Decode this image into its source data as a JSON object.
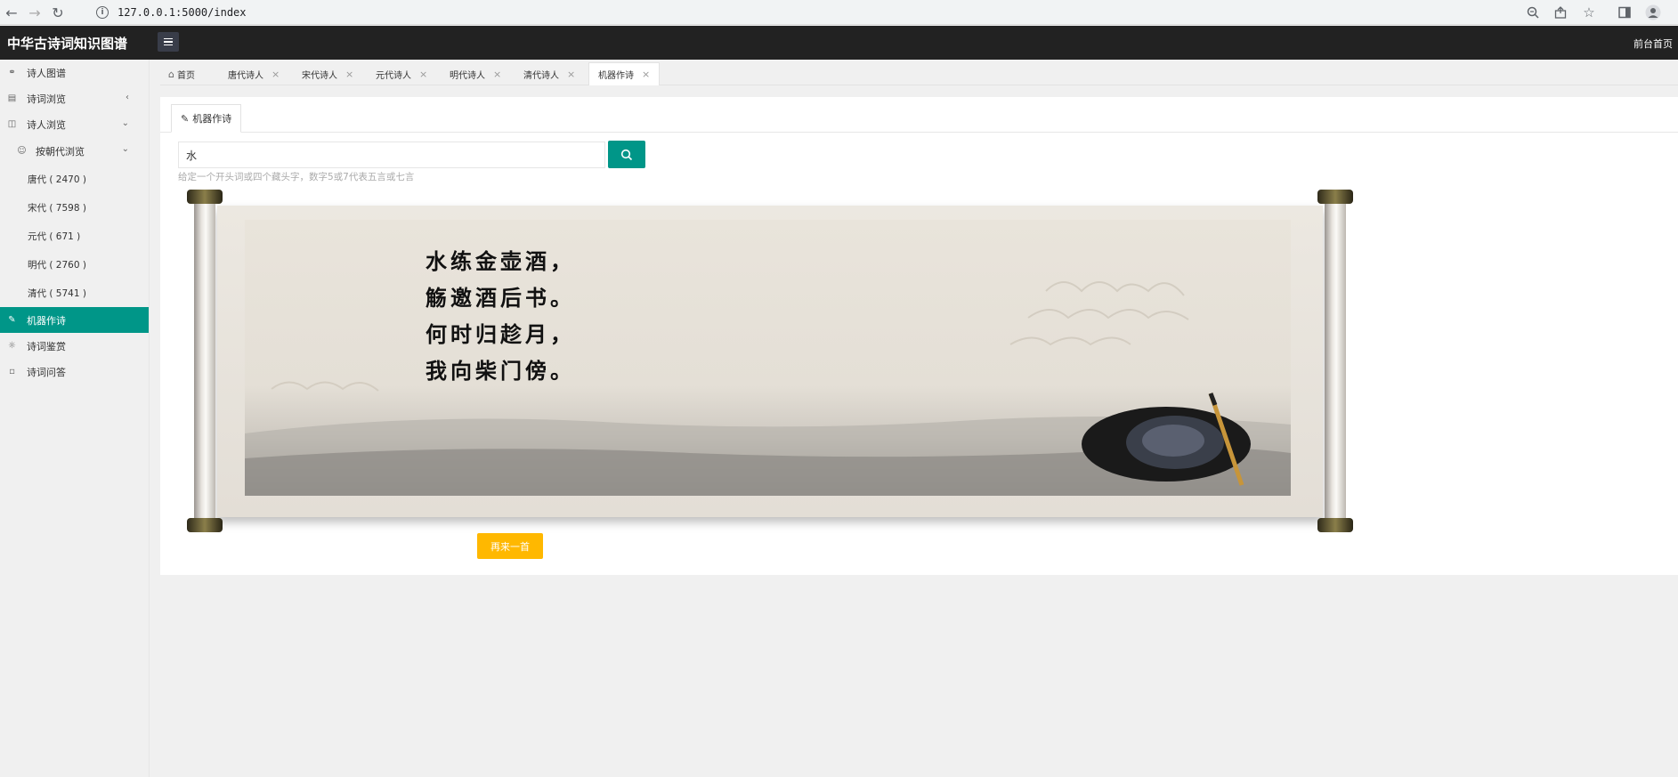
{
  "browser": {
    "url": "127.0.0.1:5000/index"
  },
  "header": {
    "title": "中华古诗词知识图谱",
    "front_link": "前台首页"
  },
  "sidebar": {
    "items": [
      {
        "label": "诗人图谱",
        "icon": "graph-icon"
      },
      {
        "label": "诗词浏览",
        "icon": "book-icon"
      },
      {
        "label": "诗人浏览",
        "icon": "read-icon"
      },
      {
        "label": "按朝代浏览",
        "icon": "user-circle-icon"
      },
      {
        "label": "唐代 ( 2470 )"
      },
      {
        "label": "宋代 ( 7598 )"
      },
      {
        "label": "元代 ( 671 )"
      },
      {
        "label": "明代 ( 2760 )"
      },
      {
        "label": "清代 ( 5741 )"
      },
      {
        "label": "机器作诗",
        "icon": "pen-icon"
      },
      {
        "label": "诗词鉴赏",
        "icon": "bulb-icon"
      },
      {
        "label": "诗词问答",
        "icon": "chat-icon"
      }
    ]
  },
  "tabs": [
    {
      "label": "首页"
    },
    {
      "label": "唐代诗人"
    },
    {
      "label": "宋代诗人"
    },
    {
      "label": "元代诗人"
    },
    {
      "label": "明代诗人"
    },
    {
      "label": "清代诗人"
    },
    {
      "label": "机器作诗"
    }
  ],
  "main": {
    "card_tab": "机器作诗",
    "search_value": "水",
    "hint": "给定一个开头词或四个藏头字，数字5或7代表五言或七言",
    "poem": [
      "水练金壶酒，",
      "觞邀酒后书。",
      "何时归趁月，",
      "我向柴门傍。"
    ],
    "again_button": "再来一首"
  },
  "colors": {
    "accent": "#009688",
    "warm": "#FFB800",
    "header_bg": "#222222"
  }
}
